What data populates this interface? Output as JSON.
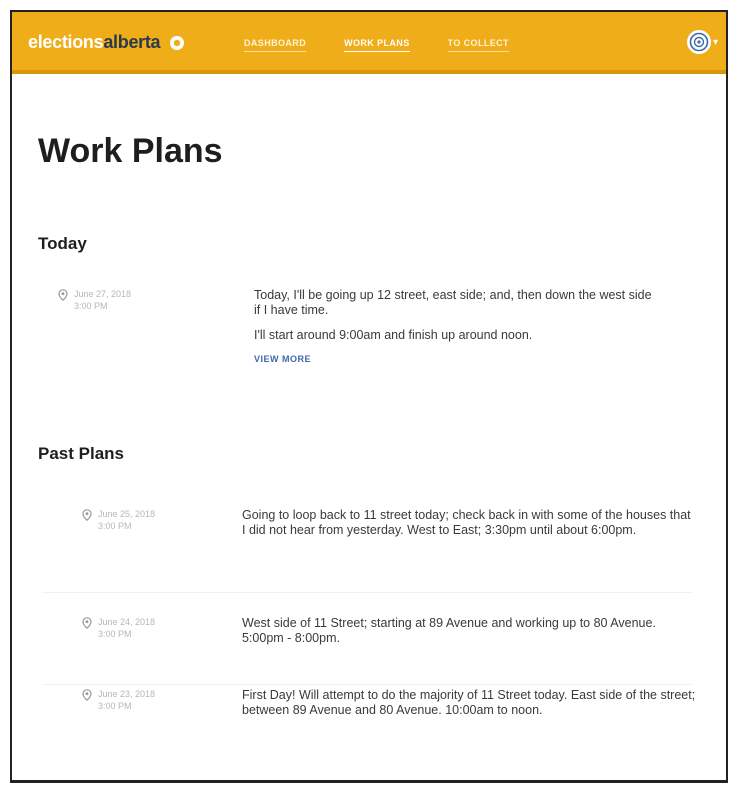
{
  "brand": {
    "part1": "elections",
    "part2": "alberta"
  },
  "nav": [
    {
      "label": "DASHBOARD"
    },
    {
      "label": "WORK PLANS"
    },
    {
      "label": "TO COLLECT"
    }
  ],
  "page_title": "Work Plans",
  "today": {
    "heading": "Today",
    "plan": {
      "date": "June 27, 2018",
      "time": "3:00 PM",
      "paragraphs": [
        "Today, I'll be going up 12 street, east side; and, then down the west side if I have time.",
        "I'll start around 9:00am and finish up around noon."
      ],
      "view_more": "VIEW MORE"
    }
  },
  "past": {
    "heading": "Past Plans",
    "plans": [
      {
        "date": "June 25, 2018",
        "time": "3:00 PM",
        "text": "Going to loop back to 11 street today; check back in with some of the houses that I did not hear from yesterday. West to East; 3:30pm until about 6:00pm."
      },
      {
        "date": "June 24, 2018",
        "time": "3:00 PM",
        "text": "West side of 11 Street; starting at 89 Avenue and working up to 80 Avenue. 5:00pm - 8:00pm."
      },
      {
        "date": "June 23, 2018",
        "time": "3:00 PM",
        "text": "First Day! Will attempt to do the majority of 11 Street today. East side of the street; between 89 Avenue and 80 Avenue. 10:00am to noon."
      }
    ]
  }
}
